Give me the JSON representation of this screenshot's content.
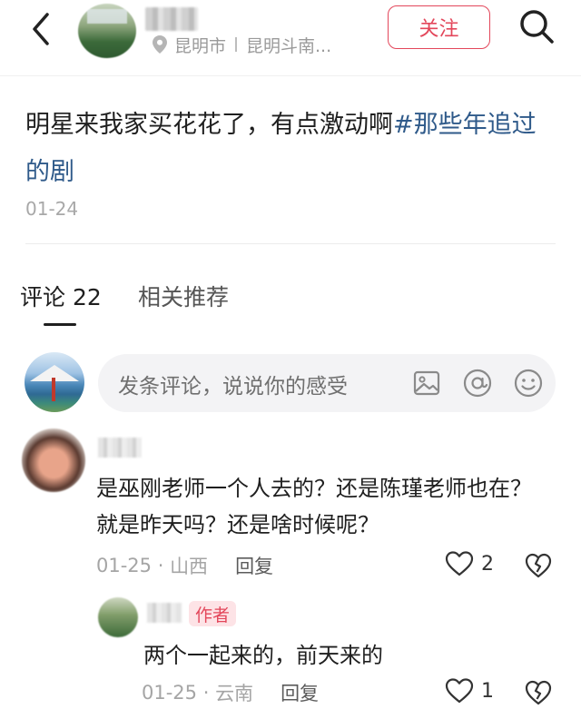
{
  "header": {
    "back_icon": "chevron-left-icon",
    "location_city": "昆明市",
    "location_detail": "昆明斗南...",
    "follow_label": "关注",
    "search_icon": "search-icon",
    "accent_color": "#e3475b"
  },
  "post": {
    "text": "明星来我家买花花了，有点激动啊",
    "hashtag": "#那些年追过的剧",
    "date": "01-24"
  },
  "tabs": [
    {
      "label": "评论 22",
      "active": true
    },
    {
      "label": "相关推荐",
      "active": false
    }
  ],
  "comment_input": {
    "placeholder": "发条评论，说说你的感受",
    "icons": [
      "image-icon",
      "at-icon",
      "emoji-icon"
    ]
  },
  "comments": [
    {
      "text": "是巫刚老师一个人去的？还是陈瑾老师也在？就是昨天吗？还是啥时候呢？",
      "date": "01-25",
      "region": "山西",
      "reply_label": "回复",
      "likes": "2"
    },
    {
      "badge": "作者",
      "text": "两个一起来的，前天来的",
      "date": "01-25",
      "region": "云南",
      "reply_label": "回复",
      "likes": "1"
    }
  ]
}
